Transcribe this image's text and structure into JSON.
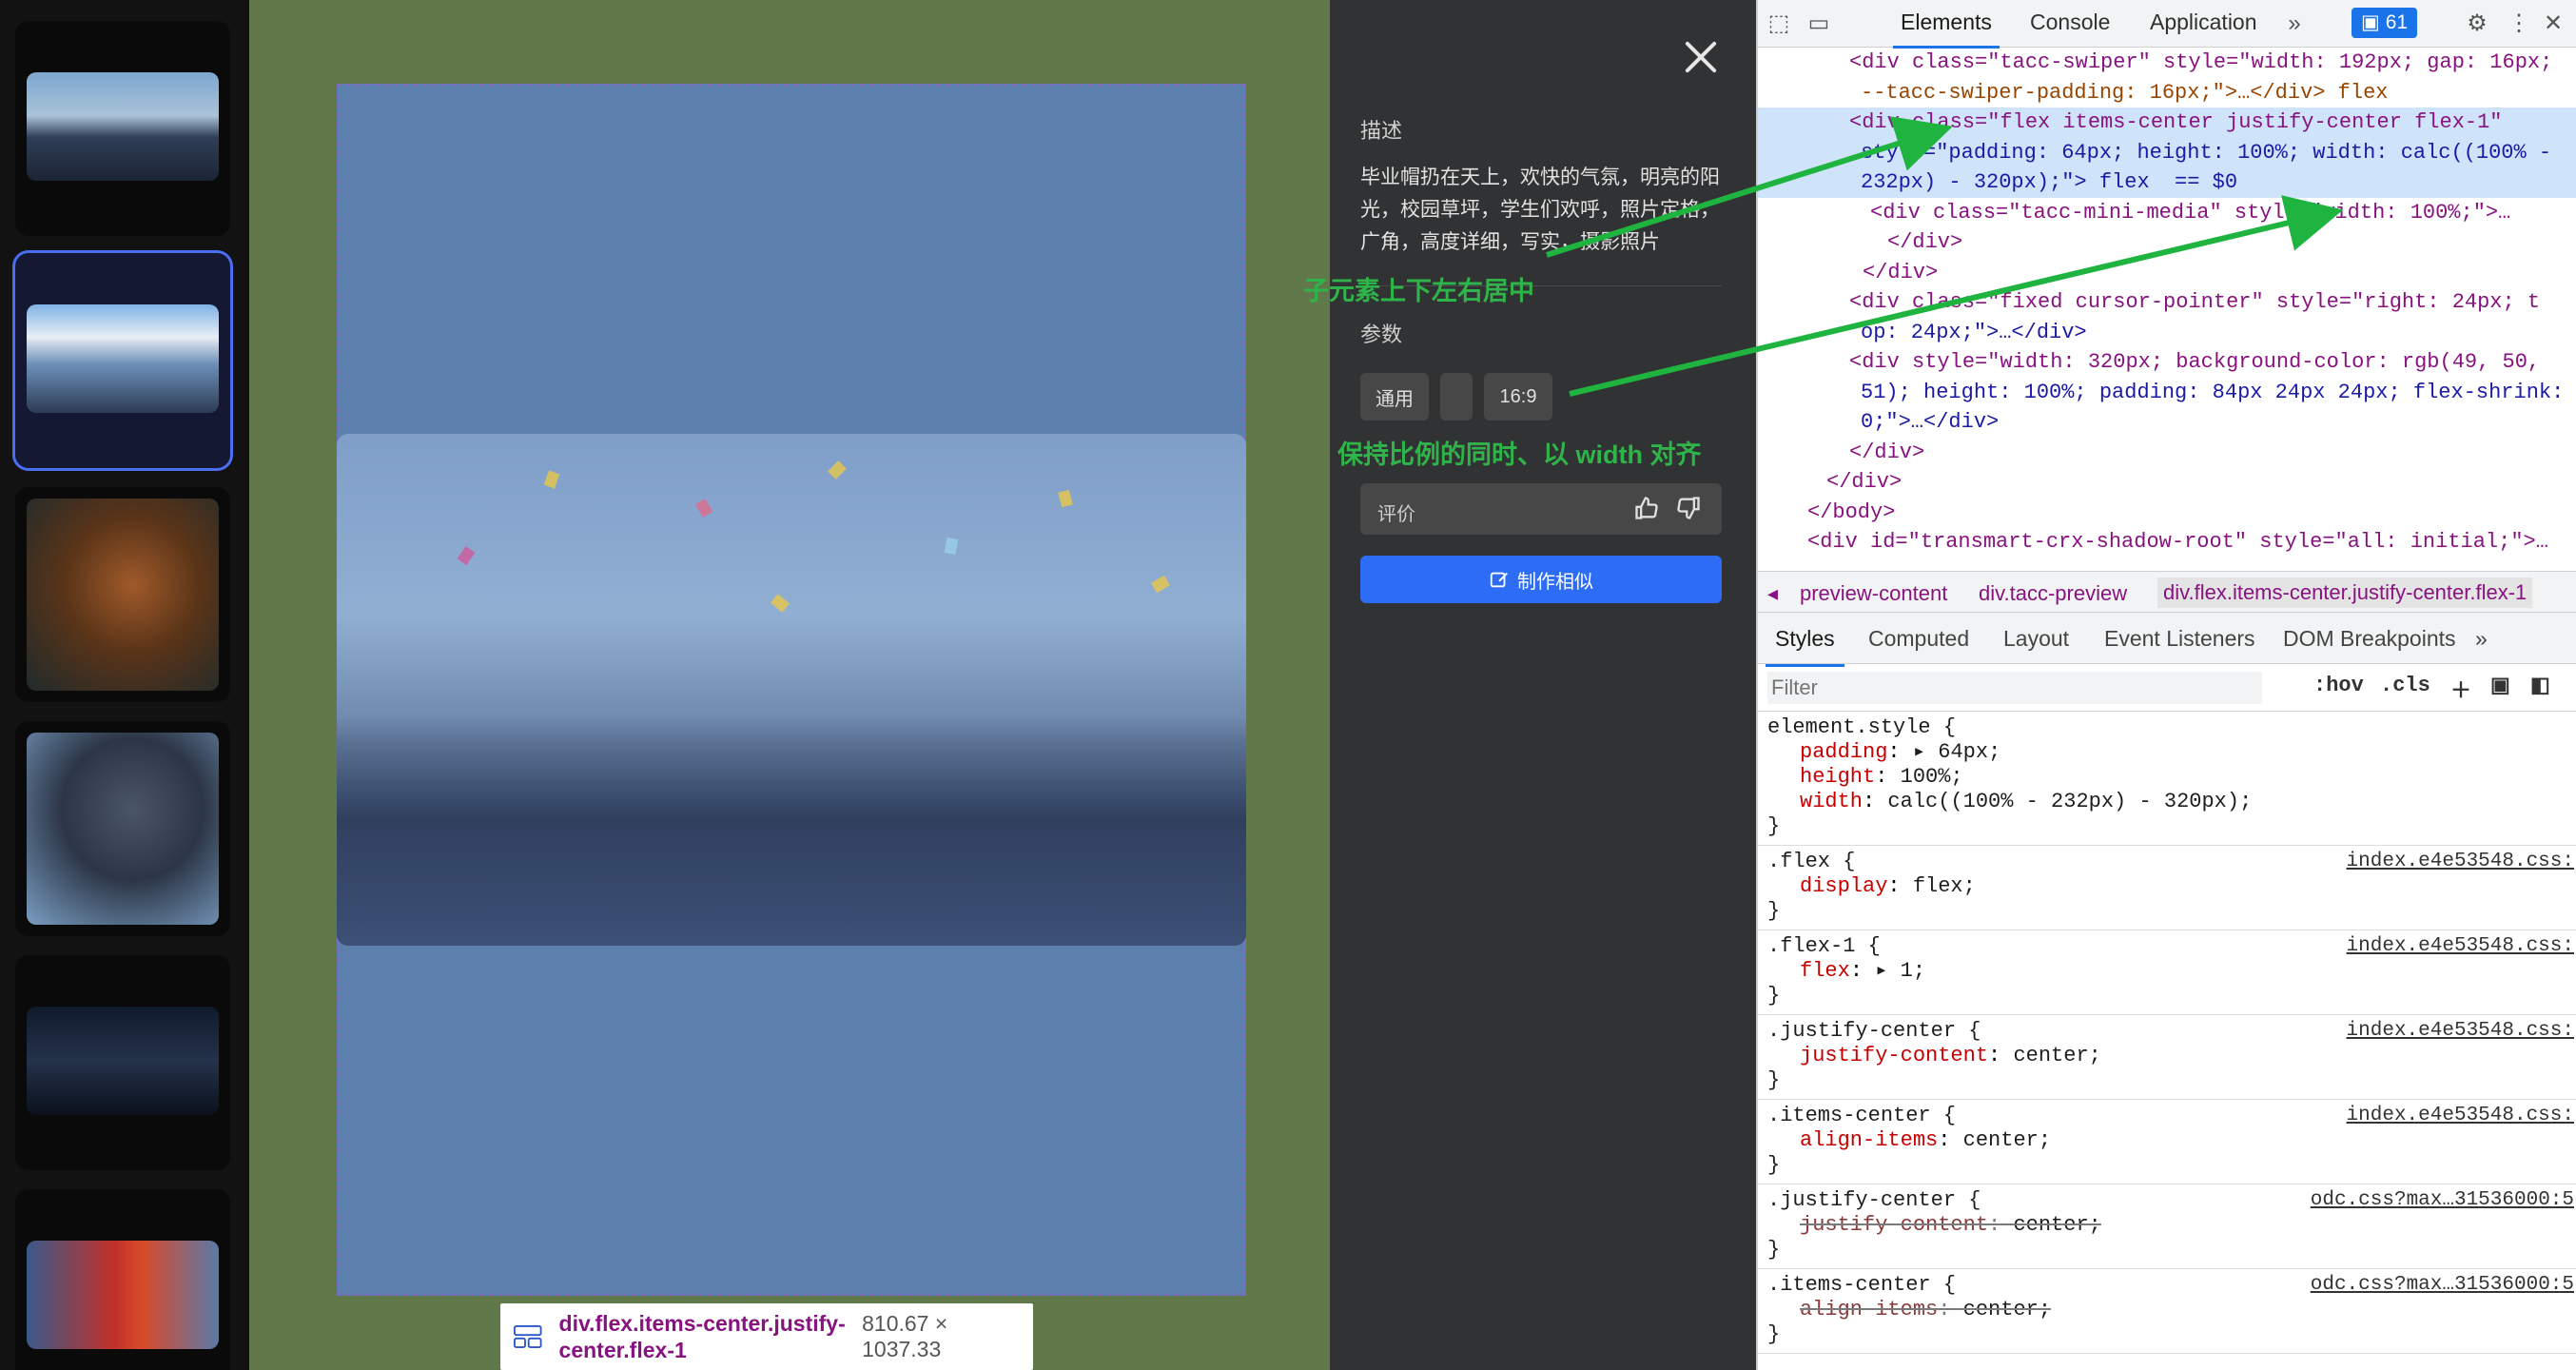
{
  "sidebar": {
    "thumbnails": [
      {
        "name": "businessman-photo",
        "active": false
      },
      {
        "name": "graduation-photo",
        "active": true
      },
      {
        "name": "dragon-creature-photo",
        "active": false
      },
      {
        "name": "armored-warrior-photo",
        "active": false
      },
      {
        "name": "man-in-suit-photo",
        "active": false
      },
      {
        "name": "woman-red-jacket-photo",
        "active": false
      }
    ]
  },
  "preview": {
    "tooltip_selector": "div.flex.items-center.justify-center.flex-1",
    "tooltip_size": "810.67 × 1037.33"
  },
  "panel": {
    "description_title": "描述",
    "description_text": "毕业帽扔在天上，欢快的气氛，明亮的阳光，校园草坪，学生们欢呼，照片定格，广角，高度详细，写实，摄影照片",
    "params_title": "参数",
    "chips": [
      "通用",
      "",
      "16:9"
    ],
    "rating_label": "评价",
    "make_similar_label": "制作相似"
  },
  "annotations": {
    "center_note": "子元素上下左右居中",
    "ratio_note": "保持比例的同时、以 width 对齐",
    "arrow_color": "#1fb43f"
  },
  "devtools": {
    "tabs": [
      "Elements",
      "Console",
      "Application"
    ],
    "issues_count": "61",
    "code_lines": [
      "<div class=\"tacc-swiper\" style=\"width: 192px; gap: 16px;",
      "--tacc-swiper-padding: 16px;\">…</div> flex",
      "<div class=\"flex items-center justify-center flex-1\"",
      "style=\"padding: 64px; height: 100%; width: calc((100% -",
      "232px) - 320px);\"> flex  == $0",
      "<div class=\"tacc-mini-media\" style=\"width: 100%;\">…",
      "</div>",
      "</div>",
      "<div class=\"fixed cursor-pointer\" style=\"right: 24px; t",
      "op: 24px;\">…</div>",
      "<div style=\"width: 320px; background-color: rgb(49, 50,",
      "51); height: 100%; padding: 84px 24px 24px; flex-shrink:",
      "0;\">…</div>",
      "</div>",
      "</div>",
      "</body>",
      "<div id=\"transmart-crx-shadow-root\" style=\"all: initial;\">…",
      "</div>"
    ],
    "breadcrumbs": [
      "preview-content",
      "div.tacc-preview",
      "div.flex.items-center.justify-center.flex-1"
    ],
    "subtabs": [
      "Styles",
      "Computed",
      "Layout",
      "Event Listeners",
      "DOM Breakpoints"
    ],
    "filter_placeholder": "Filter",
    "hov_label": ":hov",
    "cls_label": ".cls",
    "rules": [
      {
        "selector": "element.style {",
        "source": "",
        "props": [
          [
            "padding",
            "▸ 64px;"
          ],
          [
            "height",
            "100%;"
          ],
          [
            "width",
            "calc((100% - 232px) - 320px);"
          ]
        ],
        "struck": false
      },
      {
        "selector": ".flex {",
        "source": "index.e4e53548.css:",
        "props": [
          [
            "display",
            "flex;"
          ]
        ],
        "struck": false
      },
      {
        "selector": ".flex-1 {",
        "source": "index.e4e53548.css:",
        "props": [
          [
            "flex",
            "▸ 1;"
          ]
        ],
        "struck": false
      },
      {
        "selector": ".justify-center {",
        "source": "index.e4e53548.css:",
        "props": [
          [
            "justify-content",
            "center;"
          ]
        ],
        "struck": false
      },
      {
        "selector": ".items-center {",
        "source": "index.e4e53548.css:",
        "props": [
          [
            "align-items",
            "center;"
          ]
        ],
        "struck": false
      },
      {
        "selector": ".justify-center {",
        "source": "odc.css?max…31536000:5",
        "props": [
          [
            "justify-content",
            "center;"
          ]
        ],
        "struck": true
      },
      {
        "selector": ".items-center {",
        "source": "odc.css?max…31536000:5",
        "props": [
          [
            "align-items",
            "center;"
          ]
        ],
        "struck": true
      }
    ]
  }
}
